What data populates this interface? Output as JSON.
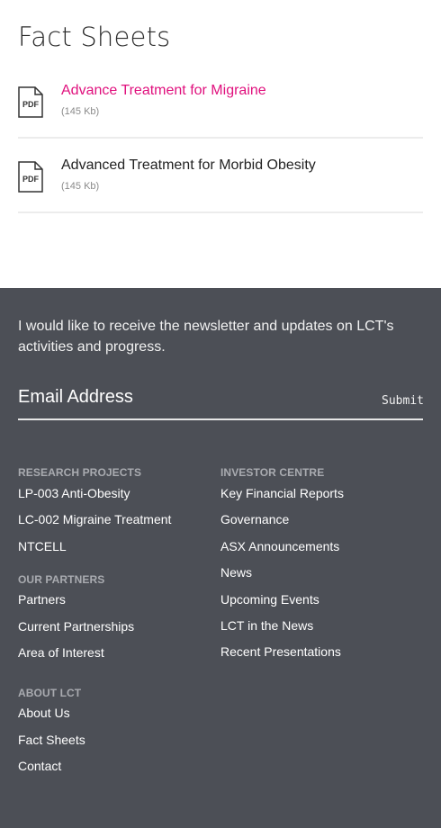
{
  "page": {
    "title": "Fact Sheets"
  },
  "documents": [
    {
      "icon": "pdf-icon",
      "icon_label": "PDF",
      "title": "Advance Treatment for Migraine",
      "size": "(145 Kb)",
      "color": "#e0107d"
    },
    {
      "icon": "pdf-icon",
      "icon_label": "PDF",
      "title": "Advanced Treatment for Morbid Obesity",
      "size": "(145 Kb)"
    }
  ],
  "footer": {
    "background": "#4c4f56",
    "newsletter_text": "I would like to receive the newsletter and updates on LCT's activities and progress.",
    "email_placeholder": "Email Address",
    "submit_label": "Submit",
    "sections": {
      "research_projects": {
        "heading": "RESEARCH PROJECTS",
        "links": [
          "LP-003 Anti-Obesity",
          "LC-002 Migraine Treatment",
          "NTCELL"
        ]
      },
      "our_partners": {
        "heading": "OUR PARTNERS",
        "links": [
          "Partners",
          "Current Partnerships",
          "Area of Interest"
        ]
      },
      "about_lct": {
        "heading": "ABOUT LCT",
        "links": [
          "About Us",
          "Fact Sheets",
          "Contact"
        ]
      },
      "investor_centre": {
        "heading": "INVESTOR CENTRE",
        "links": [
          "Key Financial Reports",
          "Governance",
          "ASX Announcements",
          "News",
          "Upcoming Events",
          "LCT in the News",
          "Recent Presentations"
        ]
      }
    }
  }
}
